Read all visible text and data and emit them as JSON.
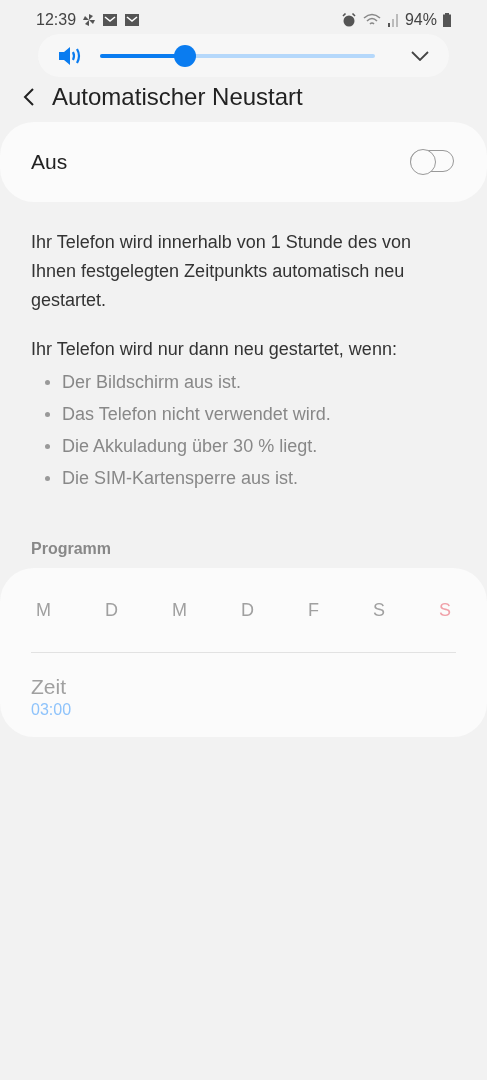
{
  "status_bar": {
    "time": "12:39",
    "battery": "94%"
  },
  "volume_panel": {
    "level": 0.31
  },
  "header": {
    "title": "Automatischer Neustart"
  },
  "master_switch": {
    "label": "Aus",
    "on": false
  },
  "description": "Ihr Telefon wird innerhalb von 1 Stunde des von Ihnen festgelegten Zeitpunkts automatisch neu gestartet.",
  "conditions": {
    "intro": "Ihr Telefon wird nur dann neu gestartet, wenn:",
    "items": [
      "Der Bildschirm aus ist.",
      "Das Telefon nicht verwendet wird.",
      "Die Akkuladung über 30 % liegt.",
      "Die SIM-Kartensperre aus ist."
    ]
  },
  "schedule": {
    "heading": "Programm",
    "disabled": true,
    "days": [
      {
        "label": "M",
        "color": "#a0a0a0"
      },
      {
        "label": "D",
        "color": "#a0a0a0"
      },
      {
        "label": "M",
        "color": "#a0a0a0"
      },
      {
        "label": "D",
        "color": "#a0a0a0"
      },
      {
        "label": "F",
        "color": "#a0a0a0"
      },
      {
        "label": "S",
        "color": "#a0a0a0"
      },
      {
        "label": "S",
        "color": "#f0a0a8"
      }
    ],
    "time_label": "Zeit",
    "time_value": "03:00"
  }
}
